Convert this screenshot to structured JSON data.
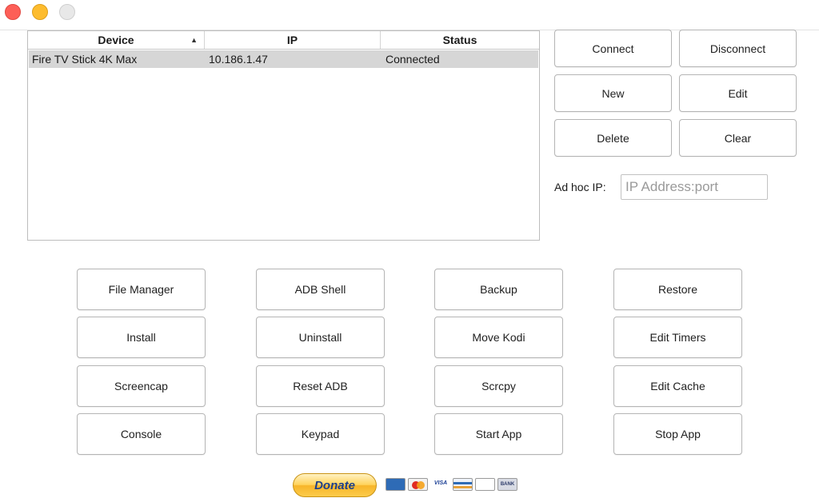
{
  "window": {
    "controls": [
      "close",
      "minimize",
      "zoom"
    ]
  },
  "device_table": {
    "columns": [
      "Device",
      "IP",
      "Status"
    ],
    "sort_column": "Device",
    "sort_direction": "ascending",
    "rows": [
      {
        "device": "Fire TV Stick 4K Max",
        "ip": "10.186.1.47",
        "status": "Connected",
        "selected": true
      }
    ]
  },
  "right_panel": {
    "connect": "Connect",
    "disconnect": "Disconnect",
    "new": "New",
    "edit": "Edit",
    "delete": "Delete",
    "clear": "Clear",
    "adhoc_label": "Ad hoc IP:",
    "adhoc_placeholder": "IP Address:port",
    "adhoc_value": ""
  },
  "actions": {
    "file_manager": "File Manager",
    "adb_shell": "ADB Shell",
    "backup": "Backup",
    "restore": "Restore",
    "install": "Install",
    "uninstall": "Uninstall",
    "move_kodi": "Move Kodi",
    "edit_timers": "Edit Timers",
    "screencap": "Screencap",
    "reset_adb": "Reset ADB",
    "scrcpy": "Scrcpy",
    "edit_cache": "Edit Cache",
    "console": "Console",
    "keypad": "Keypad",
    "start_app": "Start App",
    "stop_app": "Stop App"
  },
  "donate": {
    "label": "Donate",
    "cards": [
      "amex-icon",
      "mastercard-icon",
      "visa-icon",
      "discover-icon",
      "echeck-icon",
      "bank-icon"
    ],
    "visa_text": "VISA",
    "bank_text": "BANK"
  }
}
